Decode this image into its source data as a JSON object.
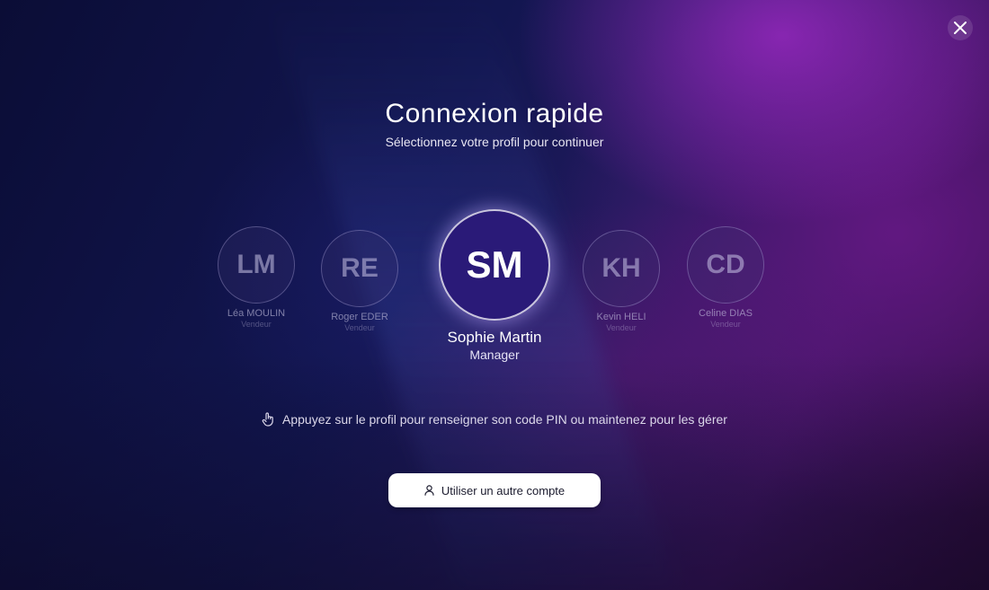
{
  "header": {
    "title": "Connexion rapide",
    "subtitle": "Sélectionnez votre profil pour continuer"
  },
  "profiles": [
    {
      "initials": "LM",
      "name": "Léa MOULIN",
      "role": "Vendeur"
    },
    {
      "initials": "RE",
      "name": "Roger EDER",
      "role": "Vendeur"
    },
    {
      "initials": "SM",
      "name": "Sophie Martin",
      "role": "Manager",
      "selected": true
    },
    {
      "initials": "KH",
      "name": "Kevin HELI",
      "role": "Vendeur"
    },
    {
      "initials": "CD",
      "name": "Celine DIAS",
      "role": "Vendeur"
    }
  ],
  "hint": {
    "icon": "hand-pointer-icon",
    "text": "Appuyez sur le profil pour renseigner son code PIN ou maintenez pour les gérer"
  },
  "actions": {
    "other_account_icon": "user-icon",
    "other_account_label": "Utiliser un autre compte",
    "close_icon": "close-icon"
  },
  "colors": {
    "accent_purple": "#8e2bb0",
    "selected_avatar": "#2a1a78",
    "background_dark": "#0d0f3c"
  }
}
